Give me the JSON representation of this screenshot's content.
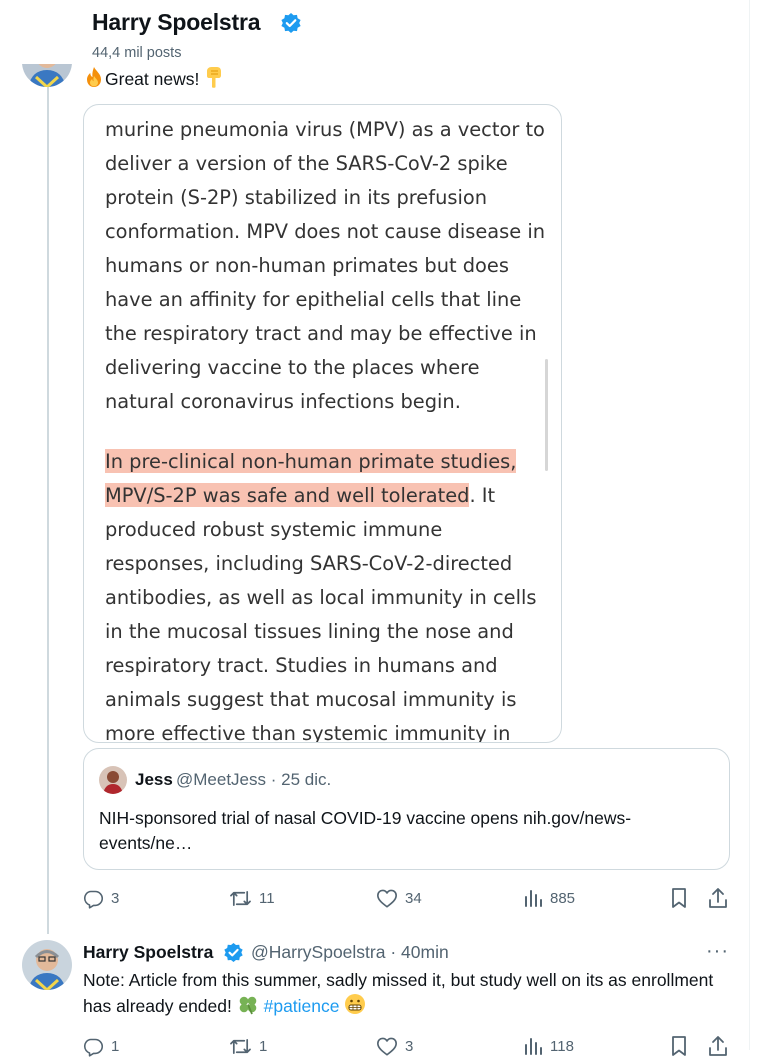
{
  "header": {
    "name": "Harry Spoelstra",
    "posts": "44,4 mil posts"
  },
  "tweet1": {
    "text": "Great news!",
    "article": {
      "para1": "murine pneumonia virus (MPV) as a vector to deliver a version of the SARS-CoV-2 spike protein (S-2P) stabilized in its prefusion conformation. MPV does not cause disease in humans or non-human primates but does have an affinity for epithelial cells that line the respiratory tract and may be effective in delivering vaccine to the places where natural coronavirus infections begin.",
      "para2_highlight": "In pre-clinical non-human primate studies, MPV/S-2P was safe and well tolerated",
      "para2_rest": ". It produced robust systemic immune responses, including SARS-CoV-2-directed antibodies, as well as local immunity in cells in the mucosal tissues lining the nose and respiratory tract. Studies in humans and animals suggest that mucosal immunity is more effective than systemic immunity in"
    },
    "quote": {
      "name": "Jess",
      "handle": "@MeetJess · 25 dic.",
      "text": "NIH-sponsored trial of nasal COVID-19 vaccine opens  nih.gov/news-events/ne…"
    },
    "actions": {
      "replies": "3",
      "reposts": "11",
      "likes": "34",
      "views": "885"
    }
  },
  "tweet2": {
    "name": "Harry Spoelstra",
    "handle": "@HarrySpoelstra · 40min",
    "more": "···",
    "text": "Note: Article from this summer, sadly missed it, but study well on its as enrollment has already ended! ",
    "hashtag": "#patience",
    "actions": {
      "replies": "1",
      "reposts": "1",
      "likes": "3",
      "views": "118"
    }
  },
  "icons": {
    "verified": "verified-badge-icon",
    "reply": "reply-icon",
    "repost": "repost-icon",
    "like": "like-icon",
    "views": "views-icon",
    "bookmark": "bookmark-icon",
    "share": "share-icon"
  },
  "colors": {
    "accent": "#1d9bf0",
    "muted": "#536471",
    "highlight": "#f8c2b2",
    "border": "#cfd9de"
  }
}
